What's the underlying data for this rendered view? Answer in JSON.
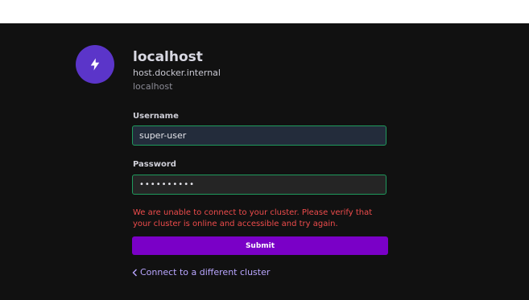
{
  "cluster": {
    "name": "localhost",
    "host": "host.docker.internal",
    "subtitle": "localhost",
    "icon": "lightning-icon"
  },
  "form": {
    "username_label": "Username",
    "username_value": "super-user",
    "password_label": "Password",
    "password_masked": "••••••••••"
  },
  "error": {
    "message": "We are unable to connect to your cluster. Please verify that your cluster is online and accessible and try again."
  },
  "actions": {
    "submit_label": "Submit",
    "back_link_label": "Connect to a different cluster"
  },
  "colors": {
    "background": "#111111",
    "accent": "#7a00c7",
    "avatar": "#5b35c9",
    "error": "#ef4c4c",
    "input_border": "#1f9a5d",
    "link": "#b9a6ff"
  }
}
